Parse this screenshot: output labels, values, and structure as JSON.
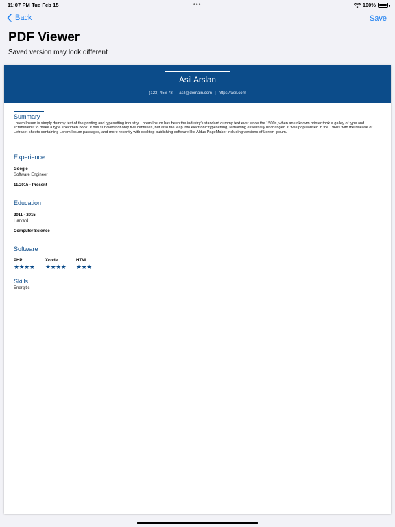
{
  "status": {
    "time": "11:07 PM   Tue Feb 15",
    "battery": "100%"
  },
  "nav": {
    "back_label": "Back",
    "save_label": "Save"
  },
  "page": {
    "title": "PDF Viewer",
    "subtitle": "Saved version may look different"
  },
  "resume": {
    "name": "Asil Arslan",
    "phone": "(123) 456-78",
    "email": "asil@domain.com",
    "website": "https://asil.com",
    "summary": {
      "title": "Summary",
      "text": "Lorem Ipsum is simply dummy text of the printing and typesetting industry. Lorem Ipsum has been the industry's standard dummy text ever since the 1500s, when an unknown printer took a galley of type and scrambled it to make a type specimen book. It has survived not only five centuries, but also the leap into electronic typesetting, remaining essentially unchanged. It was popularised in the 1960s with the release of Letraset sheets containing Lorem Ipsum passages, and more recently with desktop publishing software like Aldus PageMaker including versions of Lorem Ipsum."
    },
    "experience": {
      "title": "Experience",
      "company": "Google",
      "role": "Software Engineer",
      "dates": "11/2015 - Present"
    },
    "education": {
      "title": "Education",
      "dates": "2011 - 2015",
      "school": "Harvard",
      "field": "Computer Science"
    },
    "software": {
      "title": "Software",
      "items": [
        {
          "name": "PHP",
          "stars": "★★★★",
          "rating": 4
        },
        {
          "name": "Xcode",
          "stars": "★★★★",
          "rating": 4
        },
        {
          "name": "HTML",
          "stars": "★★★",
          "rating": 3
        }
      ]
    },
    "skills": {
      "title": "Skills",
      "text": "Energitic"
    }
  },
  "colors": {
    "accent": "#0c4c8a",
    "link": "#1a7ef0",
    "background": "#f2f2f7"
  }
}
